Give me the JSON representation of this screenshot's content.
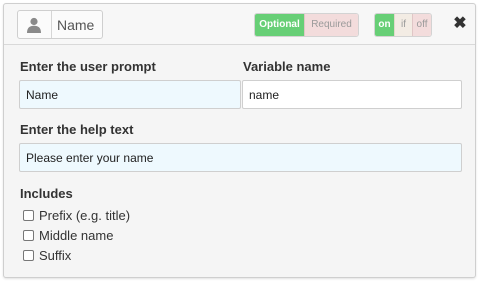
{
  "header": {
    "field_name": "Name",
    "avatar_icon": "user-icon",
    "requirement": {
      "optional": "Optional",
      "required": "Required",
      "selected": "Optional"
    },
    "visibility": {
      "on": "on",
      "if": "if",
      "off": "off",
      "selected": "on"
    },
    "close_icon": "close-icon",
    "close_glyph": "✖"
  },
  "form": {
    "prompt_label": "Enter the user prompt",
    "prompt_value": "Name",
    "variable_label": "Variable name",
    "variable_value": "name",
    "help_label": "Enter the help text",
    "help_value": "Please enter your name",
    "includes_label": "Includes",
    "includes": [
      {
        "label": "Prefix (e.g. title)",
        "checked": false
      },
      {
        "label": "Middle name",
        "checked": false
      },
      {
        "label": "Suffix",
        "checked": false
      }
    ]
  },
  "colors": {
    "accent_green": "#67cf76",
    "inactive_red": "#f3dcdc",
    "input_highlight": "#eef9fe"
  }
}
